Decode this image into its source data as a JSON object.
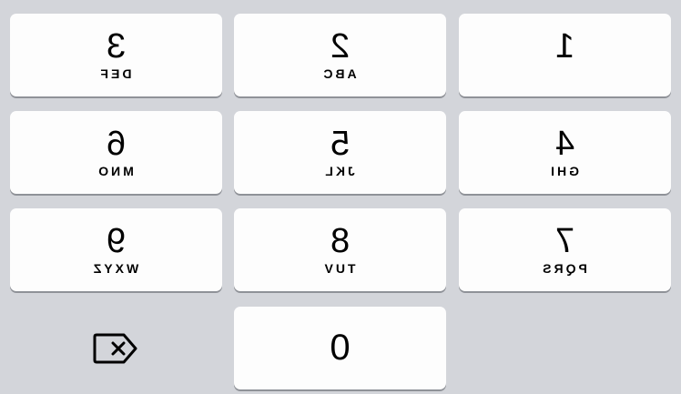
{
  "keypad": {
    "keys": [
      {
        "digit": "1",
        "letters": ""
      },
      {
        "digit": "2",
        "letters": "ABC"
      },
      {
        "digit": "3",
        "letters": "DEF"
      },
      {
        "digit": "4",
        "letters": "GHI"
      },
      {
        "digit": "5",
        "letters": "JKL"
      },
      {
        "digit": "6",
        "letters": "MNO"
      },
      {
        "digit": "7",
        "letters": "PQRS"
      },
      {
        "digit": "8",
        "letters": "TUV"
      },
      {
        "digit": "9",
        "letters": "WXYZ"
      },
      {
        "digit": "0",
        "letters": ""
      }
    ],
    "delete_icon": "backspace-icon"
  },
  "colors": {
    "background": "#d3d5da",
    "key": "#fdfdfd",
    "key_shadow": "#8f9298",
    "text": "#000000"
  }
}
